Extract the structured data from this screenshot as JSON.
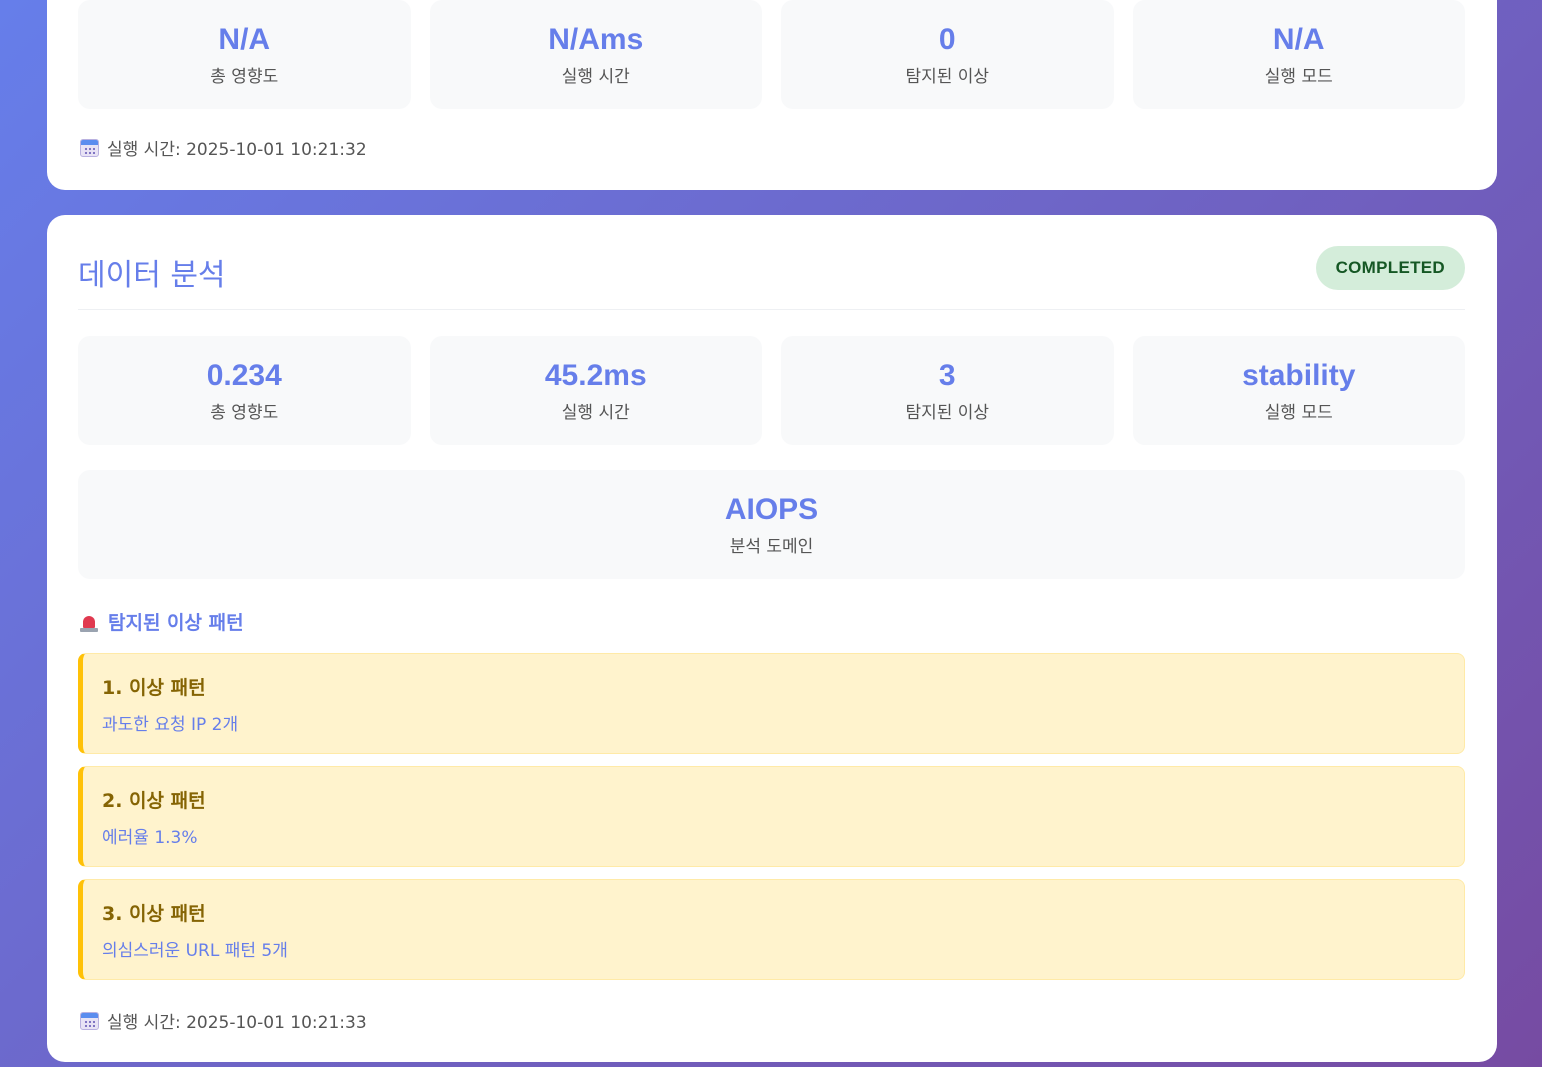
{
  "previous_result": {
    "metrics": [
      {
        "value": "N/A",
        "label": "총 영향도"
      },
      {
        "value": "N/Ams",
        "label": "실행 시간"
      },
      {
        "value": "0",
        "label": "탐지된 이상"
      },
      {
        "value": "N/A",
        "label": "실행 모드"
      }
    ],
    "timestamp": "실행 시간: 2025-10-01 10:21:32"
  },
  "data_analysis": {
    "title": "데이터 분석",
    "status": "COMPLETED",
    "metrics": [
      {
        "value": "0.234",
        "label": "총 영향도"
      },
      {
        "value": "45.2ms",
        "label": "실행 시간"
      },
      {
        "value": "3",
        "label": "탐지된 이상"
      },
      {
        "value": "stability",
        "label": "실행 모드"
      }
    ],
    "domain": {
      "value": "AIOPS",
      "label": "분석 도메인"
    },
    "patterns_heading": "탐지된 이상 패턴",
    "patterns": [
      {
        "title": "1. 이상 패턴",
        "description": "과도한 요청 IP 2개"
      },
      {
        "title": "2. 이상 패턴",
        "description": "에러율 1.3%"
      },
      {
        "title": "3. 이상 패턴",
        "description": "의심스러운 URL 패턴 5개"
      }
    ],
    "timestamp": "실행 시간: 2025-10-01 10:21:33"
  },
  "icons": {
    "calendar": "calendar-icon",
    "alarm": "rotating-light-icon"
  },
  "colors": {
    "accent": "#667eea",
    "status_bg": "#d4edda",
    "status_text": "#155724",
    "pattern_bg": "#fff3cd",
    "pattern_border": "#ffc107"
  }
}
